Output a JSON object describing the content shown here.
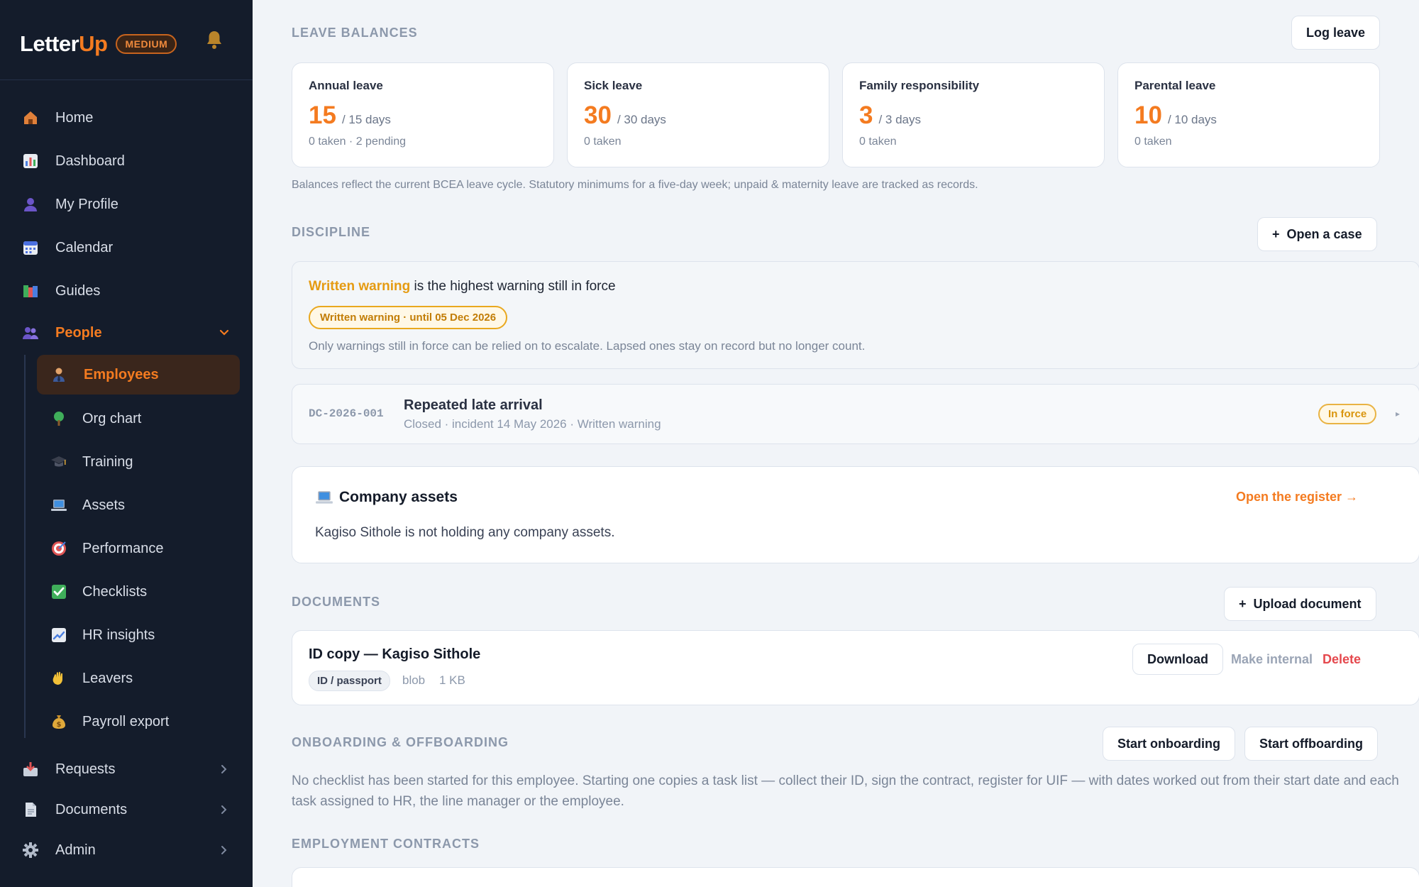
{
  "brand": {
    "logo_main": "Letter",
    "logo_accent": "Up",
    "tier": "MEDIUM"
  },
  "sidebar": {
    "items": [
      {
        "label": "Home",
        "icon": "home-icon"
      },
      {
        "label": "Dashboard",
        "icon": "chart-icon"
      },
      {
        "label": "My Profile",
        "icon": "user-icon"
      },
      {
        "label": "Calendar",
        "icon": "calendar-icon"
      },
      {
        "label": "Guides",
        "icon": "books-icon"
      },
      {
        "label": "People",
        "icon": "people-icon",
        "expanded": true
      },
      {
        "label": "Requests",
        "icon": "inbox-icon"
      },
      {
        "label": "Documents",
        "icon": "document-icon"
      },
      {
        "label": "Admin",
        "icon": "gear-icon"
      }
    ],
    "people_children": [
      {
        "label": "Employees",
        "icon": "employee-icon",
        "selected": true
      },
      {
        "label": "Org chart",
        "icon": "tree-icon"
      },
      {
        "label": "Training",
        "icon": "graduation-cap-icon"
      },
      {
        "label": "Assets",
        "icon": "laptop-icon"
      },
      {
        "label": "Performance",
        "icon": "target-icon"
      },
      {
        "label": "Checklists",
        "icon": "check-box-icon"
      },
      {
        "label": "HR insights",
        "icon": "trend-icon"
      },
      {
        "label": "Leavers",
        "icon": "wave-icon"
      },
      {
        "label": "Payroll export",
        "icon": "money-bag-icon"
      }
    ]
  },
  "leave": {
    "title": "LEAVE BALANCES",
    "log_button": "Log leave",
    "cards": [
      {
        "name": "Annual leave",
        "value": "15",
        "total": "/ 15 days",
        "sub": "0 taken · 2 pending"
      },
      {
        "name": "Sick leave",
        "value": "30",
        "total": "/ 30 days",
        "sub": "0 taken"
      },
      {
        "name": "Family responsibility",
        "value": "3",
        "total": "/ 3 days",
        "sub": "0 taken"
      },
      {
        "name": "Parental leave",
        "value": "10",
        "total": "/ 10 days",
        "sub": "0 taken"
      }
    ],
    "note": "Balances reflect the current BCEA leave cycle. Statutory minimums for a five-day week; unpaid & maternity leave are tracked as records."
  },
  "discipline": {
    "title": "DISCIPLINE",
    "open_button": "Open a case",
    "highest_level": "Written warning",
    "highest_suffix": " is the highest warning still in force",
    "pill": "Written warning · until 05 Dec 2026",
    "note": "Only warnings still in force can be relied on to escalate. Lapsed ones stay on record but no longer count.",
    "case": {
      "id": "DC-2026-001",
      "title": "Repeated late arrival",
      "meta": "Closed · incident 14 May 2026 · Written warning",
      "status": "In force"
    }
  },
  "assets": {
    "title": "Company assets",
    "link": "Open the register →",
    "empty": "Kagiso Sithole is not holding any company assets."
  },
  "documents": {
    "title": "DOCUMENTS",
    "upload_button": "Upload document",
    "item": {
      "title": "ID copy — Kagiso Sithole",
      "tag": "ID / passport",
      "storage": "blob",
      "size": "1 KB",
      "download": "Download",
      "make_internal": "Make internal",
      "delete": "Delete"
    }
  },
  "onboarding": {
    "title": "ONBOARDING & OFFBOARDING",
    "start_onboarding": "Start onboarding",
    "start_offboarding": "Start offboarding",
    "note": "No checklist has been started for this employee. Starting one copies a task list — collect their ID, sign the contract, register for UIF — with dates worked out from their start date and each task assigned to HR, the line manager or the employee."
  },
  "contracts": {
    "title": "EMPLOYMENT CONTRACTS"
  },
  "colors": {
    "accent": "#f47b20",
    "warning": "#e59b12",
    "danger": "#e5484d",
    "sidebar": "#141c2b"
  }
}
